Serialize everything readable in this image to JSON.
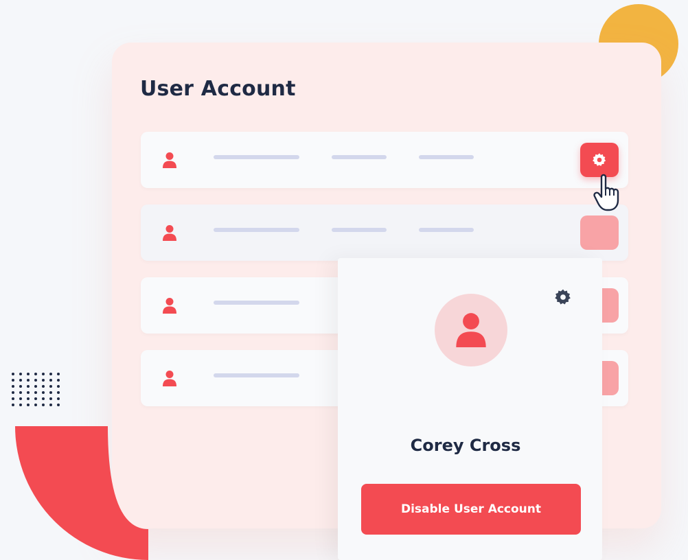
{
  "panel": {
    "title": "User Account"
  },
  "user_card": {
    "name": "Corey Cross",
    "disable_label": "Disable User Account"
  },
  "colors": {
    "accent": "#f34b52",
    "accent_faded": "#f8a3a6",
    "yellow": "#f2b441",
    "panel_bg": "#fdeceb",
    "text_dark": "#1f2a44",
    "placeholder_bar": "#d3d7ec"
  },
  "icons": [
    "user-icon",
    "gear-icon",
    "hand-cursor-icon"
  ]
}
